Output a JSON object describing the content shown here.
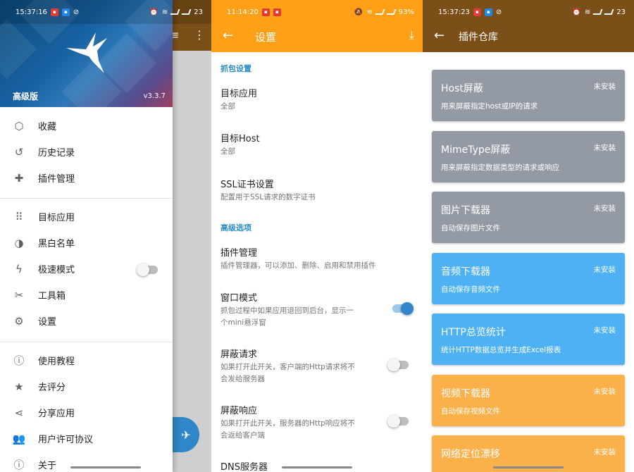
{
  "colors": {
    "accent_blue": "#2f86c8",
    "settings_bar": "#ffa017",
    "plugin_bar": "#7a4f18",
    "card_gray": "#939aa3",
    "card_blue": "#4db1f4",
    "card_orange": "#fbb04a"
  },
  "pane1": {
    "status": {
      "time": "15:37:16",
      "battery": "23"
    },
    "header": {
      "edition": "高级版",
      "version": "v3.3.7"
    },
    "menu_group1": [
      {
        "icon": "cube-icon",
        "label": "收藏"
      },
      {
        "icon": "history-icon",
        "label": "历史记录"
      },
      {
        "icon": "puzzle-icon",
        "label": "插件管理"
      }
    ],
    "menu_group2": [
      {
        "icon": "grid-icon",
        "label": "目标应用"
      },
      {
        "icon": "contrast-icon",
        "label": "黑白名单"
      },
      {
        "icon": "bolt-icon",
        "label": "极速模式",
        "toggle": false
      },
      {
        "icon": "tools-icon",
        "label": "工具箱"
      },
      {
        "icon": "gear-icon",
        "label": "设置"
      }
    ],
    "menu_group3": [
      {
        "icon": "help-icon",
        "label": "使用教程"
      },
      {
        "icon": "star-icon",
        "label": "去评分"
      },
      {
        "icon": "share-icon",
        "label": "分享应用"
      },
      {
        "icon": "people-icon",
        "label": "用户许可协议"
      },
      {
        "icon": "info-icon",
        "label": "关于"
      }
    ]
  },
  "pane2": {
    "status": {
      "time": "11:14:20",
      "battery": "93%"
    },
    "title": "设置",
    "section_capture": "抓包设置",
    "items_capture": [
      {
        "title": "目标应用",
        "subtitle": "全部"
      },
      {
        "title": "目标Host",
        "subtitle": "全部"
      },
      {
        "title": "SSL证书设置",
        "subtitle": "配置用于SSL请求的数字证书"
      }
    ],
    "section_advanced": "高级选项",
    "items_advanced": [
      {
        "title": "插件管理",
        "subtitle": "插件管理器，可以添加、删除、启用和禁用插件"
      },
      {
        "title": "窗口模式",
        "subtitle_l1": "抓包过程中如果应用退回到后台，显示一",
        "subtitle_l2": "个mini悬浮窗",
        "toggle": true
      },
      {
        "title": "屏蔽请求",
        "subtitle_l1": "如果打开此开关，客户端的Http请求将不",
        "subtitle_l2": "会发给服务器",
        "toggle": false
      },
      {
        "title": "屏蔽响应",
        "subtitle_l1": "如果打开此开关，服务器的Http响应将不",
        "subtitle_l2": "会返给客户端",
        "toggle": false
      },
      {
        "title": "DNS服务器"
      }
    ]
  },
  "pane3": {
    "status": {
      "time": "15:37:23",
      "battery": "23"
    },
    "title": "插件仓库",
    "plugins": [
      {
        "name": "Host屏蔽",
        "desc": "用来屏蔽指定host或IP的请求",
        "badge": "未安装",
        "color": "#939aa3"
      },
      {
        "name": "MimeType屏蔽",
        "desc": "用来屏蔽指定数据类型的请求或响应",
        "badge": "未安装",
        "color": "#939aa3"
      },
      {
        "name": "图片下载器",
        "desc": "自动保存图片文件",
        "badge": "未安装",
        "color": "#939aa3"
      },
      {
        "name": "音频下载器",
        "desc": "自动保存音频文件",
        "badge": "未安装",
        "color": "#4db1f4"
      },
      {
        "name": "HTTP总览统计",
        "desc": "统计HTTP数据总览并生成Excel报表",
        "badge": "未安装",
        "color": "#4db1f4"
      },
      {
        "name": "视频下载器",
        "desc": "自动保存视频文件",
        "badge": "未安装",
        "color": "#fbb04a"
      },
      {
        "name": "网络定位漂移",
        "desc": "",
        "badge": "未安装",
        "color": "#fbb04a"
      }
    ]
  }
}
